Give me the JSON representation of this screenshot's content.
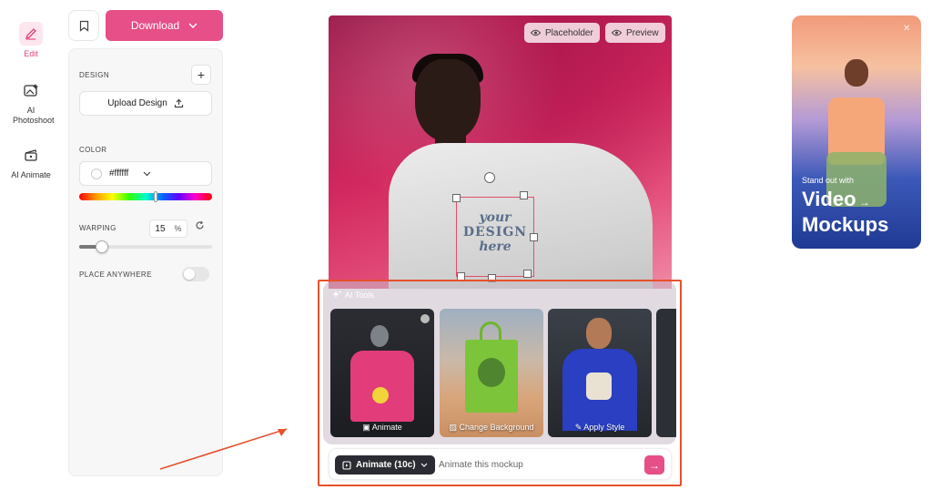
{
  "rail": {
    "items": [
      {
        "label": "Edit",
        "icon": "edit-icon"
      },
      {
        "label": "AI Photoshoot",
        "icon": "ai-photoshoot-icon"
      },
      {
        "label": "AI Animate",
        "icon": "clapper-icon"
      }
    ]
  },
  "toolbar": {
    "download_label": "Download"
  },
  "panel": {
    "design_title": "DESIGN",
    "upload_label": "Upload Design",
    "color_title": "COLOR",
    "color_value": "#ffffff",
    "warping_title": "WARPING",
    "warping_value": "15",
    "warping_unit": "%",
    "place_anywhere_title": "PLACE ANYWHERE",
    "place_anywhere_enabled": false
  },
  "canvas": {
    "placeholder_label": "Placeholder",
    "preview_label": "Preview",
    "design_line1": "your",
    "design_line2": "DESIGN",
    "design_line3": "here"
  },
  "ai_tools": {
    "title": "AI Tools",
    "tools": [
      {
        "label": "Animate"
      },
      {
        "label": "Change Background"
      },
      {
        "label": "Apply Style"
      }
    ]
  },
  "prompt": {
    "mode_label": "Animate (10c)",
    "placeholder": "Animate this mockup"
  },
  "promo": {
    "subtitle": "Stand out with",
    "title_line1": "Video",
    "title_line2": "Mockups"
  },
  "colors": {
    "accent": "#e64f87",
    "highlight": "#e8502c"
  }
}
